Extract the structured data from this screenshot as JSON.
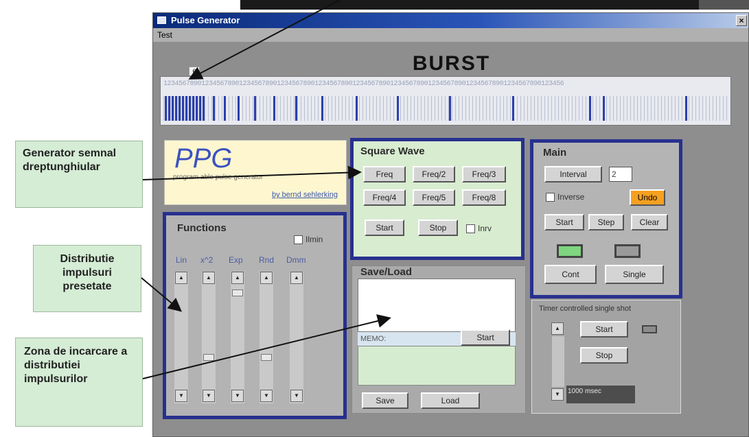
{
  "window": {
    "title": "Pulse Generator",
    "menu": [
      "Test"
    ]
  },
  "burst": {
    "title": "BURST",
    "cursor_marker": "6",
    "digit_sequence": "1234567890123456789012345678901234567890123456789012345678901234567890123456789012345678901234567890123456"
  },
  "logo": {
    "name": "PPG",
    "subtitle": "program able pulse generator",
    "author": "by bernd sehlerking"
  },
  "square_wave": {
    "title": "Square Wave",
    "buttons": [
      "Freq",
      "Freq/2",
      "Freq/3",
      "Freq/4",
      "Freq/5",
      "Freq/8"
    ],
    "start_label": "Start",
    "stop_label": "Stop",
    "checkbox_label": "Inrv"
  },
  "main": {
    "title": "Main",
    "interval_label": "Interval",
    "interval_value": "2",
    "inverse_label": "Inverse",
    "undo_label": "Undo",
    "start_label": "Start",
    "step_label": "Step",
    "clear_label": "Clear",
    "cont_label": "Cont",
    "single_label": "Single"
  },
  "functions": {
    "title": "Functions",
    "checkbox_label": "Ilmin",
    "labels": [
      "Lin",
      "x^2",
      "Exp",
      "Rnd",
      "Dmm"
    ]
  },
  "save_load": {
    "title": "Save/Load",
    "memo_label": "MEMO:",
    "start_label": "Start",
    "save_label": "Save",
    "load_label": "Load"
  },
  "timer": {
    "title": "Timer controlled single shot",
    "start_label": "Start",
    "stop_label": "Stop",
    "msec_value": "1000 msec"
  },
  "annotations": {
    "a1": "Generator semnal dreptunghiular",
    "a2": "Distributie impulsuri presetate",
    "a3": "Zona de incarcare a distributiei impulsurilor"
  },
  "colors": {
    "frame_blue": "#27308e",
    "pulse_blue": "#2a3fae",
    "annotation_green": "#d5ecd5",
    "undo_orange": "#f5a020"
  }
}
